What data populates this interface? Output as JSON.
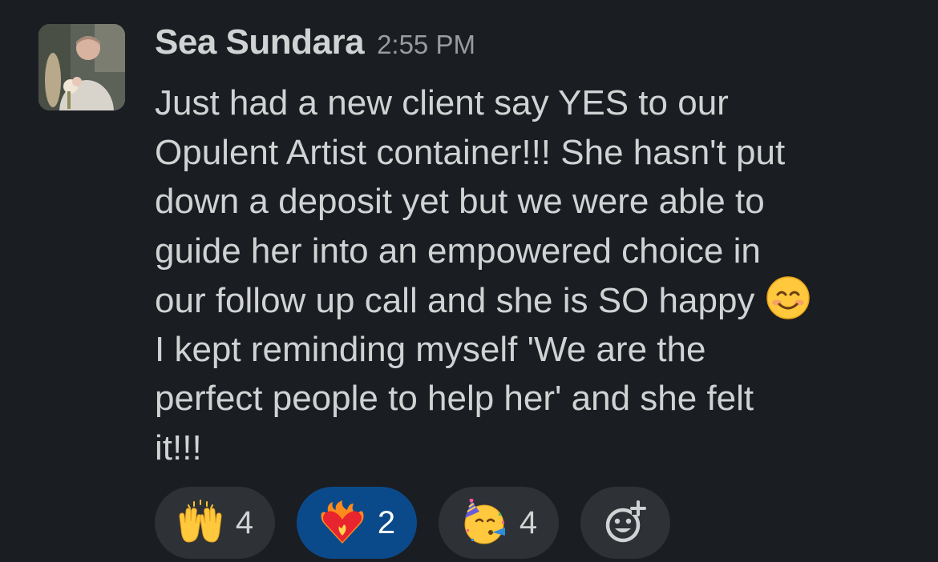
{
  "message": {
    "sender": "Sea Sundara",
    "timestamp": "2:55 PM",
    "avatar_icon": "profile-photo",
    "lines": [
      "Just had a new client say YES to our",
      "Opulent Artist container!!! She hasn't put",
      "down a deposit yet but we were able to",
      "guide her into an empowered choice in",
      "our follow up call and she is SO happy",
      "I kept reminding myself 'We are the",
      "perfect people to help her' and she felt",
      "it!!!"
    ],
    "inline_emoji": "smiling-face-with-smiling-eyes-emoji"
  },
  "reactions": [
    {
      "emoji": "raising-hands-emoji",
      "count": "4",
      "selected": false
    },
    {
      "emoji": "heart-on-fire-emoji",
      "count": "2",
      "selected": true
    },
    {
      "emoji": "partying-face-emoji",
      "count": "4",
      "selected": false
    }
  ],
  "add_reaction": {
    "icon": "add-reaction-icon"
  },
  "colors": {
    "background": "#1a1d21",
    "text": "#d1d2d3",
    "timestamp": "#9a9b9d",
    "pill": "#2e3135",
    "pill_selected": "#0b4a8a"
  }
}
